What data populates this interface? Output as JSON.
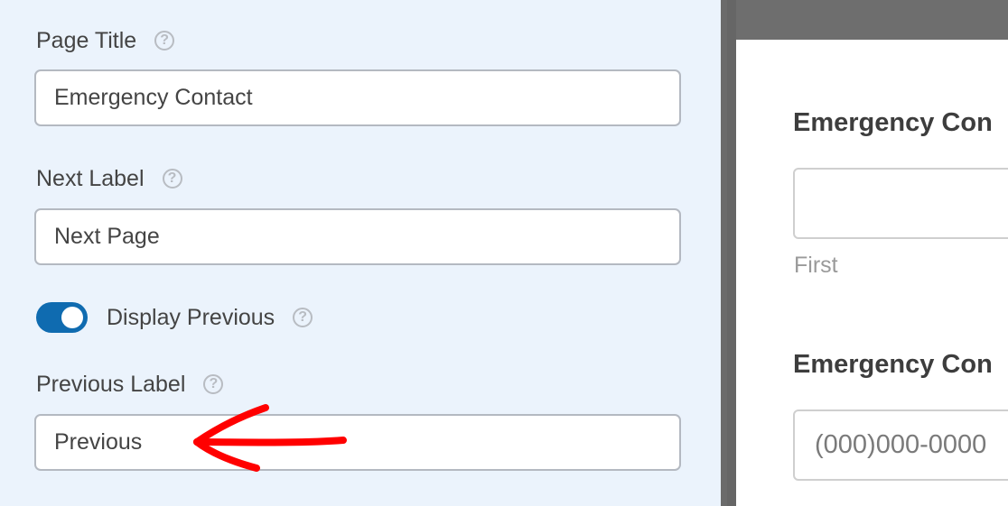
{
  "settings": {
    "page_title": {
      "label": "Page Title",
      "value": "Emergency Contact",
      "help_icon": "question-circle-icon"
    },
    "next_label": {
      "label": "Next Label",
      "value": "Next Page",
      "help_icon": "question-circle-icon"
    },
    "display_previous": {
      "label": "Display Previous",
      "enabled": true,
      "help_icon": "question-circle-icon"
    },
    "previous_label": {
      "label": "Previous Label",
      "value": "Previous",
      "help_icon": "question-circle-icon"
    }
  },
  "preview": {
    "fields": [
      {
        "heading": "Emergency Con",
        "sublabel": "First",
        "placeholder": ""
      },
      {
        "heading": "Emergency Con",
        "placeholder": "(000)000-0000"
      }
    ]
  },
  "annotation": {
    "type": "red-arrow",
    "points_to": "previous-label-input",
    "color": "#ff0000"
  },
  "colors": {
    "panel_bg": "#ebf3fc",
    "toggle_on": "#0f6bb0",
    "divider": "#6b6b6b",
    "text": "#444444"
  }
}
